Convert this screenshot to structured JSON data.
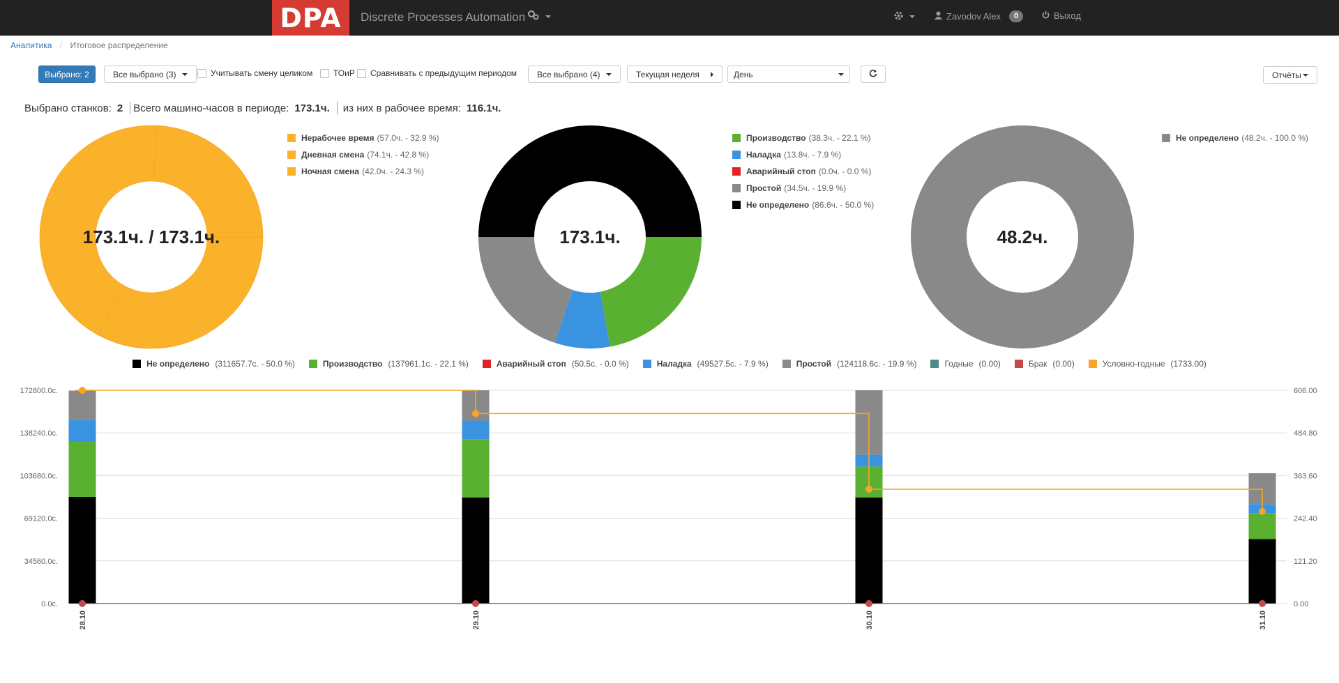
{
  "navbar": {
    "logo_text": "DPA",
    "title": "Discrete Processes Automation",
    "settings_icon": "gear-icon",
    "integrations_icon": "cogs-icon",
    "user_name": "Zavodov Alex",
    "notifications_count": "0",
    "logout_label": "Выход"
  },
  "breadcrumb": {
    "root": "Аналитика",
    "current": "Итоговое распределение"
  },
  "toolbar": {
    "selected_label": "Выбрано: 2",
    "all_selected_machines": "Все выбрано (3)",
    "whole_shift_label": "Учитывать смену целиком",
    "toir_label": "ТОиР",
    "compare_label": "Сравнивать с предыдущим периодом",
    "all_selected_states": "Все выбрано (4)",
    "period_label": "Текущая неделя",
    "granularity_value": "День",
    "reports_label": "Отчёты"
  },
  "summary": {
    "machines_label": "Выбрано станков:",
    "machines_value": "2",
    "hours_label": "Всего машино-часов в периоде:",
    "hours_value": "173.1ч.",
    "work_hours_label": "из них в рабочее время:",
    "work_hours_value": "116.1ч."
  },
  "donuts": [
    {
      "center": "173.1ч. / 173.1ч.",
      "slices": [
        {
          "label": "Нерабочее время",
          "detail": "(57.0ч. - 32.9 %)",
          "value": 57.0,
          "color": "#fbb22b"
        },
        {
          "label": "Дневная смена",
          "detail": "(74.1ч. - 42.8 %)",
          "value": 74.1,
          "color": "#fbb22b"
        },
        {
          "label": "Ночная смена",
          "detail": "(42.0ч. - 24.3 %)",
          "value": 42.0,
          "color": "#fbb22b"
        }
      ]
    },
    {
      "center": "173.1ч.",
      "slices": [
        {
          "label": "Производство",
          "detail": "(38.3ч. - 22.1 %)",
          "value": 38.3,
          "color": "#5ab031"
        },
        {
          "label": "Наладка",
          "detail": "(13.8ч. - 7.9 %)",
          "value": 13.8,
          "color": "#3a93e0"
        },
        {
          "label": "Аварийный стоп",
          "detail": "(0.0ч. - 0.0 %)",
          "value": 0.0,
          "color": "#e02323"
        },
        {
          "label": "Простой",
          "detail": "(34.5ч. - 19.9 %)",
          "value": 34.5,
          "color": "#898989"
        },
        {
          "label": "Не определено",
          "detail": "(86.6ч. - 50.0 %)",
          "value": 86.6,
          "color": "#000000"
        }
      ]
    },
    {
      "center": "48.2ч.",
      "slices": [
        {
          "label": "Не определено",
          "detail": "(48.2ч. - 100.0 %)",
          "value": 48.2,
          "color": "#898989"
        }
      ]
    }
  ],
  "chart_data": {
    "type": "bar",
    "categories": [
      "28.10",
      "29.10",
      "30.10",
      "31.10"
    ],
    "y_left_ticks": [
      "0.0с.",
      "34560.0с.",
      "69120.0с.",
      "103680.0с.",
      "138240.0с.",
      "172800.0с."
    ],
    "y_right_ticks": [
      "0.00",
      "121.20",
      "242.40",
      "363.60",
      "484.80",
      "606.00"
    ],
    "ylim_left": [
      0,
      172800
    ],
    "ylim_right": [
      0,
      606
    ],
    "series": [
      {
        "name": "Не определено",
        "detail": "(311657.7с. - 50.0 %)",
        "color": "#000000",
        "values": [
          86400,
          86000,
          86000,
          52200
        ]
      },
      {
        "name": "Производство",
        "detail": "(137961.1с. - 22.1 %)",
        "color": "#5ab031",
        "values": [
          44600,
          47200,
          25000,
          21100
        ]
      },
      {
        "name": "Аварийный стоп",
        "detail": "(50.5с. - 0.0 %)",
        "color": "#e02323",
        "values": [
          20,
          20,
          10,
          0
        ]
      },
      {
        "name": "Наладка",
        "detail": "(49527.5с. - 7.9 %)",
        "color": "#3a93e0",
        "values": [
          17700,
          15000,
          9500,
          7300
        ]
      },
      {
        "name": "Простой",
        "detail": "(124118.6с. - 19.9 %)",
        "color": "#898989",
        "values": [
          23800,
          24600,
          52300,
          25000
        ]
      },
      {
        "name": "Годные",
        "detail": "(0.00)",
        "color": "#508b8b",
        "values": [
          0,
          0,
          0,
          0
        ]
      },
      {
        "name": "Брак",
        "detail": "(0.00)",
        "color": "#c24a4a",
        "line": true,
        "values": [
          0,
          0,
          0,
          0
        ]
      },
      {
        "name": "Условно-годные",
        "detail": "(1733.00)",
        "color": "#f7a526",
        "line": true,
        "values": [
          606,
          540,
          325,
          262
        ]
      }
    ]
  }
}
